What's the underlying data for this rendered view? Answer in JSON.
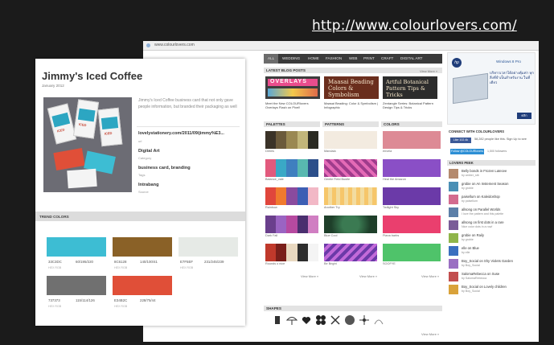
{
  "caption": {
    "url": "http://www.colourlovers.com/"
  },
  "browser": {
    "address": "www.colourlovers.com",
    "nav": [
      "ALL",
      "WEDDING",
      "HOME",
      "FASHION",
      "WEB",
      "PRINT",
      "CRAFT",
      "DIGITAL ART"
    ],
    "latest_blog": {
      "heading": "LATEST BLOG POSTS",
      "more": "View More »",
      "posts": [
        {
          "thumb": "OVERLAYS",
          "title": "Meet the New COLOURlovers Overlays Flash on Pixel!",
          "color": "#3d3d3d"
        },
        {
          "thumb": "Maasai Beading Colors & Symbolism",
          "title": "Maasai Beading: Color & Symbolism | Infographic",
          "color": "#6a2e1d"
        },
        {
          "thumb": "Artful Botanical Pattern Tips & Tricks",
          "title": "Zentangle Series: Botanical Pattern Design Tips & Tricks",
          "color": "#2c2c2c"
        }
      ]
    },
    "palettes": {
      "heading": "PALETTES",
      "more": "View More »",
      "items": [
        "Debris",
        "Balance_vale",
        "Rainbow",
        "Dark Fall",
        "Rounds o nice"
      ]
    },
    "patterns": {
      "heading": "PATTERNS",
      "more": "View More »",
      "items": [
        "Mandala",
        "Gentle Field Bustle",
        "Another Try",
        "Blue Cool",
        "Be Bright"
      ]
    },
    "colors": {
      "heading": "COLORS",
      "more": "View More »",
      "items": [
        "envela",
        "Heal the Amazon",
        "Twilight Sky",
        "Piana barbs",
        "SOOFYE"
      ]
    },
    "shapes": {
      "heading": "SHAPES",
      "more": "View More »"
    },
    "sidebar": {
      "ad": {
        "hp": "hp",
        "windows": "Windows 8 Pro",
        "thai": "บริหารเวลาได้อย่างคุ้มค่า ทุกสิ่งที่จำเป็นสำหรับงาน ในที่เดียว",
        "button": "คลิก"
      },
      "connect": "CONNECT WITH COLOURLOVERS",
      "fb_button": "Like 102.4k",
      "fb_text": "58,282 people like this. Sign Up to see",
      "tw_button": "Follow @COLOURlovers",
      "tw_text": "1,500 followers",
      "lovers_peek": "LOVERS PEEK",
      "peek": [
        {
          "title": "Belly bonds in Frozen Latecee",
          "sub": "by amber_stb",
          "color": "#b48a6e"
        },
        {
          "title": "grobie on An Instement Season",
          "sub": "by grobie",
          "color": "#4a8fb5"
        },
        {
          "title": "paisellum on Kaleidoshop",
          "sub": "by paisellum",
          "color": "#d36b8e"
        },
        {
          "title": "allsong on Parallel Worlds",
          "sub": "I love the pattern and this palette",
          "color": "#5c7fa8"
        },
        {
          "title": "allsong on first dots in a rare",
          "sub": "Nice color dots in a row!",
          "color": "#7a5c98"
        },
        {
          "title": "grobie on Raily",
          "sub": "by grobie",
          "color": "#8fb54a"
        },
        {
          "title": "elle on Blue",
          "sub": "by elle",
          "color": "#3a6fbf"
        },
        {
          "title": "Boy_Social on Shy Violets Garden",
          "sub": "by Boy_Social",
          "color": "#9a6fc2"
        },
        {
          "title": "SalomaRebecca on Suse",
          "sub": "by SalomaRebecca",
          "color": "#c24e4e"
        },
        {
          "title": "Boy_Social on Lovely children",
          "sub": "by Boy_Social",
          "color": "#d9a23a"
        }
      ]
    }
  },
  "card": {
    "title": "Jimmy's Iced Coffee",
    "date": "January 2012",
    "description": "Jimmy's Iced Coffee business card that not only gave people information, but branded their packaging as well",
    "link": "lovelystationery.com/2011/09/jimmy%E3...",
    "link_sub": "url",
    "meta": [
      {
        "title": "Digital Art",
        "sub": "Category"
      },
      {
        "title": "business card, branding",
        "sub": "Tags"
      },
      {
        "title": "Intrabang",
        "sub": "Source"
      }
    ],
    "trend_heading": "TREND COLORS",
    "trends": [
      {
        "hex": "#3dbdd3",
        "code": "33C3DC",
        "rgb": "60/195/220",
        "sub": "HEX   RGB"
      },
      {
        "hex": "#8a6127",
        "code": "8C6128",
        "rgb": "140/100/41",
        "sub": "HEX   RGB"
      },
      {
        "hex": "#e6eae6",
        "code": "E7F5EF",
        "rgb": "231/245/239",
        "sub": "HEX   RGB"
      },
      {
        "hex": "#707070",
        "code": "737373",
        "rgb": "115/114/126",
        "sub": "HEX   RGB"
      },
      {
        "hex": "#e04f38",
        "code": "E34B2C",
        "rgb": "228/75/44",
        "sub": "HEX   RGB"
      }
    ]
  }
}
